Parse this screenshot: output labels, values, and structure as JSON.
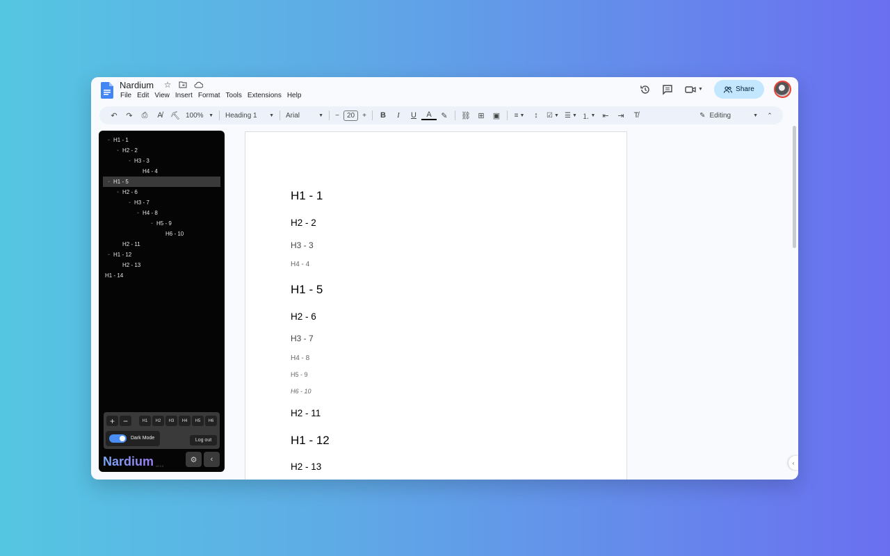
{
  "app": {
    "title": "Nardium",
    "menu": [
      "File",
      "Edit",
      "View",
      "Insert",
      "Format",
      "Tools",
      "Extensions",
      "Help"
    ],
    "share_label": "Share"
  },
  "toolbar": {
    "zoom": "100%",
    "style": "Heading 1",
    "font": "Arial",
    "font_size": "20",
    "mode": "Editing"
  },
  "outline": [
    {
      "label": "H1 - 1",
      "level": 1,
      "chevron": true,
      "active": false
    },
    {
      "label": "H2 - 2",
      "level": 2,
      "chevron": true,
      "active": false
    },
    {
      "label": "H3 - 3",
      "level": 3,
      "chevron": true,
      "active": false
    },
    {
      "label": "H4 - 4",
      "level": 4,
      "chevron": false,
      "active": false
    },
    {
      "label": "H1 - 5",
      "level": 1,
      "chevron": true,
      "active": true
    },
    {
      "label": "H2 - 6",
      "level": 2,
      "chevron": true,
      "active": false
    },
    {
      "label": "H3 - 7",
      "level": 3,
      "chevron": true,
      "active": false
    },
    {
      "label": "H4 - 8",
      "level": 4,
      "chevron": true,
      "active": false
    },
    {
      "label": "H5 - 9",
      "level": 5,
      "chevron": true,
      "active": false
    },
    {
      "label": "H6 - 10",
      "level": 6,
      "chevron": false,
      "active": false
    },
    {
      "label": "H2 - 11",
      "level": 2,
      "chevron": false,
      "active": false
    },
    {
      "label": "H1 - 12",
      "level": 1,
      "chevron": true,
      "active": false
    },
    {
      "label": "H2 - 13",
      "level": 2,
      "chevron": false,
      "active": false
    },
    {
      "label": "H1 - 14",
      "level": 0,
      "chevron": false,
      "active": false
    }
  ],
  "panel": {
    "heading_buttons": [
      "H1",
      "H2",
      "H3",
      "H4",
      "H5",
      "H6"
    ],
    "dark_mode_label": "Dark Mode",
    "dark_mode_on": true,
    "logout_label": "Log out"
  },
  "brand": {
    "name": "Nardium",
    "version": "v0.1.0"
  },
  "document": {
    "headings": [
      {
        "text": "H1 - 1",
        "level": 1
      },
      {
        "text": "H2 - 2",
        "level": 2
      },
      {
        "text": "H3 - 3",
        "level": 3
      },
      {
        "text": "H4 - 4",
        "level": 4
      },
      {
        "text": "H1 - 5",
        "level": 1
      },
      {
        "text": "H2 - 6",
        "level": 2
      },
      {
        "text": "H3 - 7",
        "level": 3
      },
      {
        "text": "H4 - 8",
        "level": 4
      },
      {
        "text": "H5 - 9",
        "level": 5
      },
      {
        "text": "H6 - 10",
        "level": 6
      },
      {
        "text": "H2 - 11",
        "level": 2
      },
      {
        "text": "H1 - 12",
        "level": 1
      },
      {
        "text": "H2 - 13",
        "level": 2
      }
    ]
  }
}
